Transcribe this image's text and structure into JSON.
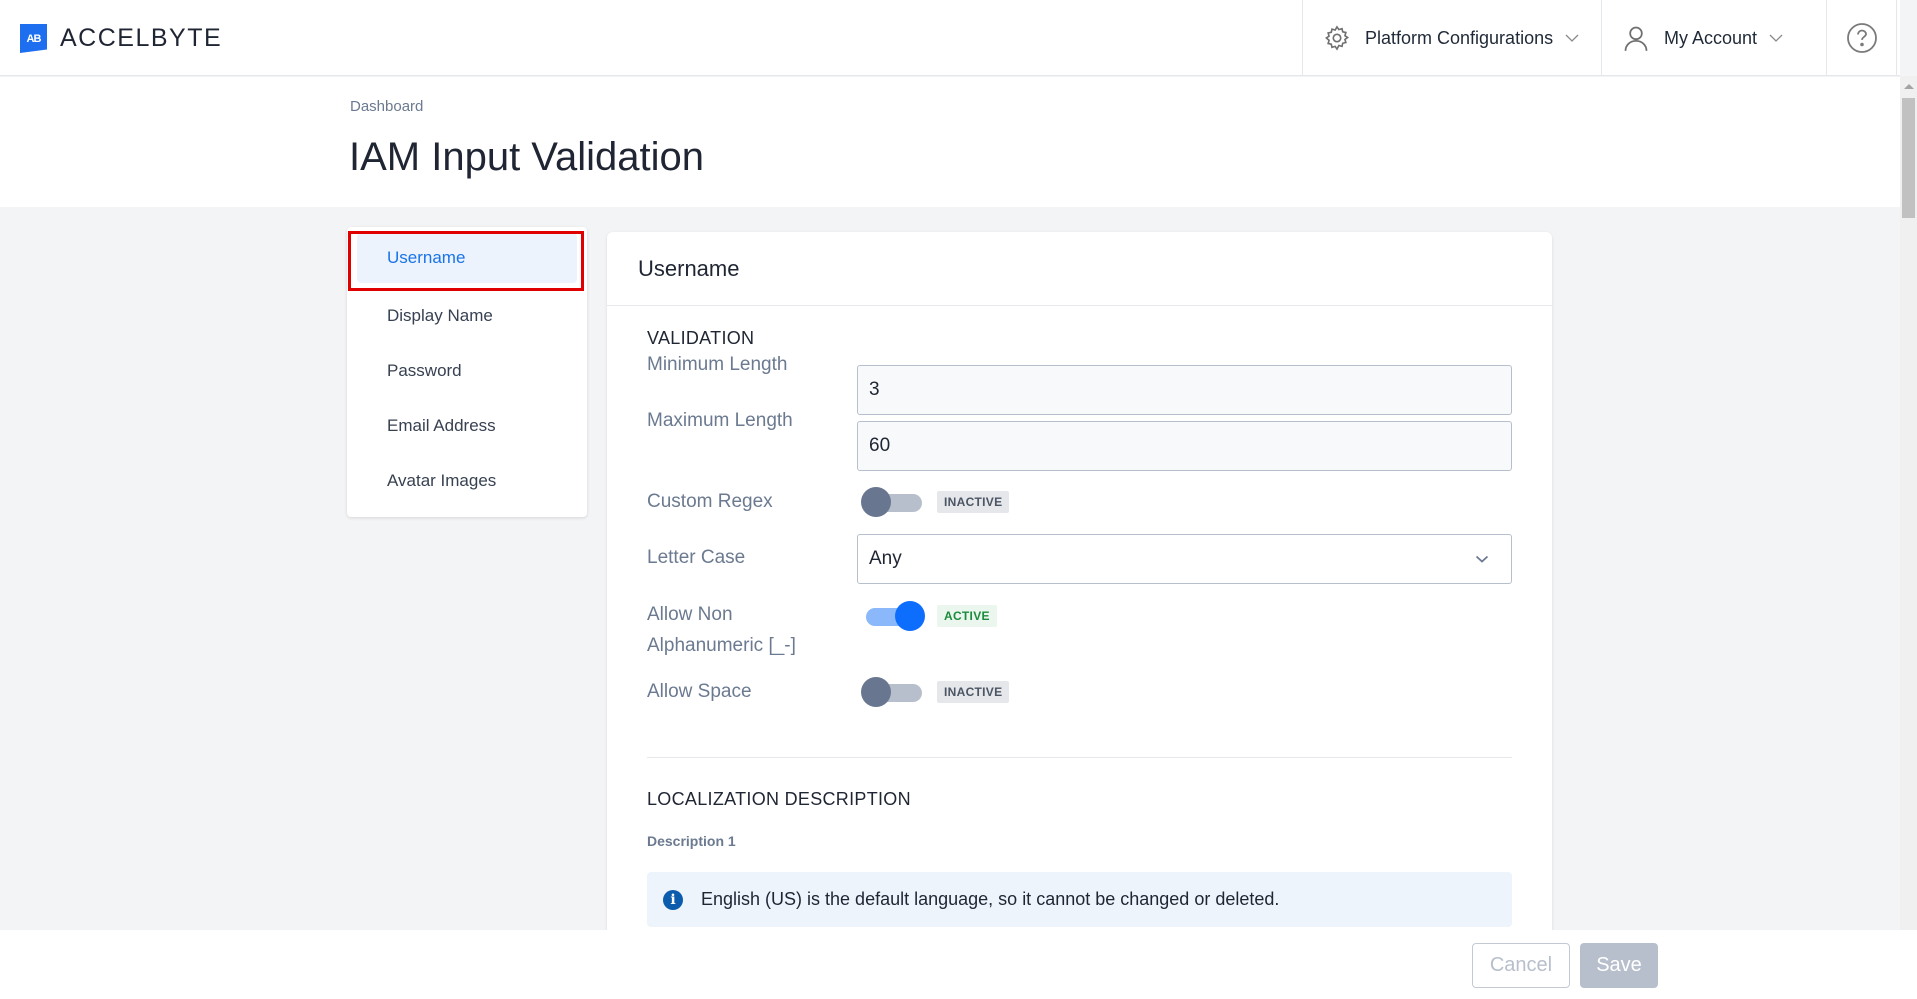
{
  "nav": {
    "brand": "ACCELBYTE",
    "brand_mark": "AB",
    "platform_label": "Platform Configurations",
    "account_label": "My Account",
    "help_icon": "question-circle-icon"
  },
  "page": {
    "breadcrumb": "Dashboard",
    "title": "IAM Input Validation"
  },
  "sidebar": {
    "items": [
      {
        "label": "Username",
        "active": true
      },
      {
        "label": "Display Name",
        "active": false
      },
      {
        "label": "Password",
        "active": false
      },
      {
        "label": "Email Address",
        "active": false
      },
      {
        "label": "Avatar Images",
        "active": false
      }
    ]
  },
  "card": {
    "title": "Username",
    "validation": {
      "section_title": "VALIDATION",
      "min_length": {
        "label": "Minimum Length",
        "value": "3"
      },
      "max_length": {
        "label": "Maximum Length",
        "value": "60"
      },
      "custom_regex": {
        "label": "Custom Regex",
        "enabled": false,
        "status": "INACTIVE"
      },
      "letter_case": {
        "label": "Letter Case",
        "value": "Any"
      },
      "allow_non_alnum": {
        "label_line1": "Allow Non",
        "label_line2": "Alphanumeric [_-]",
        "enabled": true,
        "status": "ACTIVE"
      },
      "allow_space": {
        "label": "Allow Space",
        "enabled": false,
        "status": "INACTIVE"
      }
    },
    "localization": {
      "section_title": "LOCALIZATION DESCRIPTION",
      "description_label": "Description 1",
      "info_icon_glyph": "i",
      "info_text": "English (US) is the default language, so it cannot be changed or deleted."
    }
  },
  "footer": {
    "cancel_label": "Cancel",
    "save_label": "Save"
  },
  "colors": {
    "brand": "#1e6ef0",
    "active_nav": "#1a73e8",
    "highlight_border": "#e00000",
    "toggle_on": "#0d6efd",
    "active_badge": "#1c8c3c"
  }
}
